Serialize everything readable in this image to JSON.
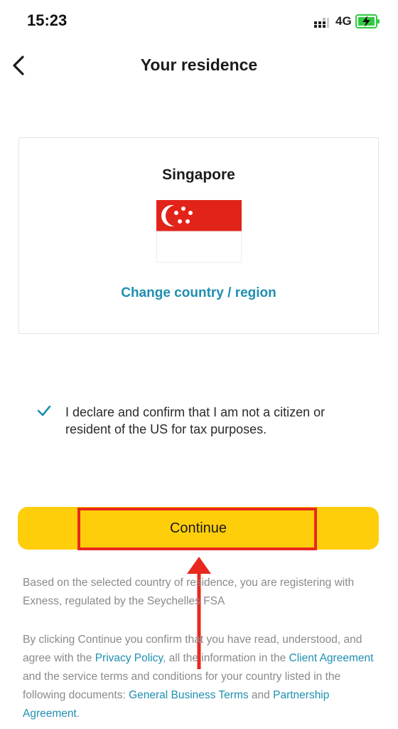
{
  "status_bar": {
    "time": "15:23",
    "network": "4G",
    "icons": [
      "signal-icon",
      "battery-charging-icon"
    ]
  },
  "header": {
    "title": "Your residence",
    "back_icon": "chevron-left-icon"
  },
  "country_card": {
    "country": "Singapore",
    "flag_icon": "singapore-flag-icon",
    "change_link": "Change country / region"
  },
  "declaration": {
    "checked": true,
    "text": "I declare and confirm that I am not a citizen or resident of the US for tax purposes."
  },
  "continue_button": {
    "label": "Continue"
  },
  "info": {
    "registration_text": "Based on the selected country of residence, you are registering with Exness, regulated by the Seychelles FSA",
    "consent": {
      "part1": "By clicking Continue you confirm that you have read, understood, and agree with the ",
      "privacy_policy": "Privacy Policy",
      "part2": ", all the information in the ",
      "client_agreement": "Client Agreement",
      "part3": " and the service terms and conditions for your country listed in the following documents: ",
      "general_business_terms": "General Business Terms",
      "part4": " and ",
      "partnership_agreement": "Partnership Agreement",
      "part5": "."
    }
  },
  "colors": {
    "accent": "#ffce0a",
    "link": "#1f8fb0",
    "annotation": "#e8281e",
    "flag_red": "#e2231a"
  }
}
